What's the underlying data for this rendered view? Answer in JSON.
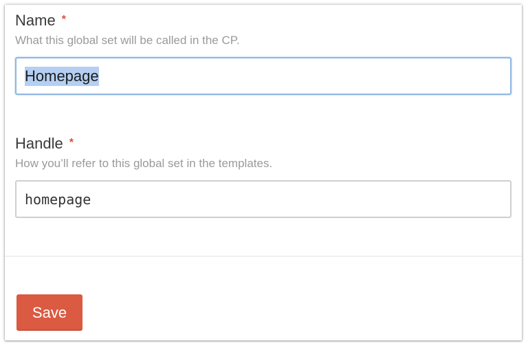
{
  "form": {
    "name": {
      "label": "Name",
      "required_mark": "*",
      "instructions": "What this global set will be called in the CP.",
      "value": "Homepage"
    },
    "handle": {
      "label": "Handle",
      "required_mark": "*",
      "instructions": "How you’ll refer to this global set in the templates.",
      "value": "homepage"
    },
    "save_label": "Save"
  },
  "colors": {
    "accent": "#db5a42",
    "required": "#d9503c",
    "focus_border": "#8fb7e3",
    "selection": "#b4cff2"
  }
}
